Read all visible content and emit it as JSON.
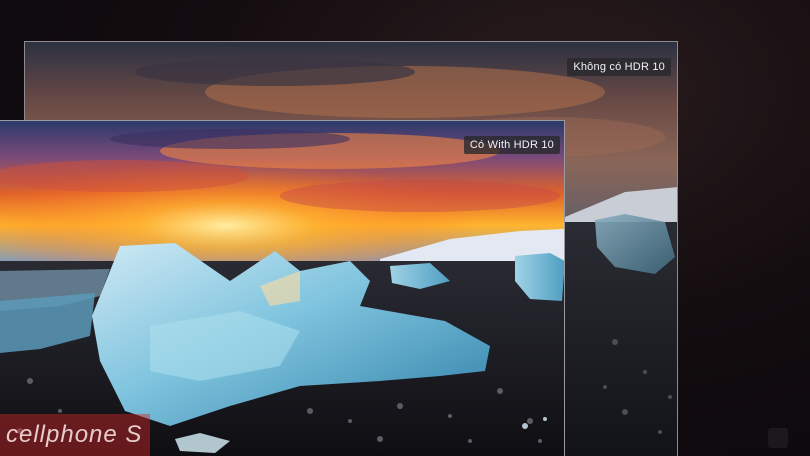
{
  "comparison": {
    "without_hdr_label": "Không có HDR 10",
    "with_hdr_label": "Có With HDR 10"
  },
  "watermark": {
    "text": "cellphone S"
  }
}
